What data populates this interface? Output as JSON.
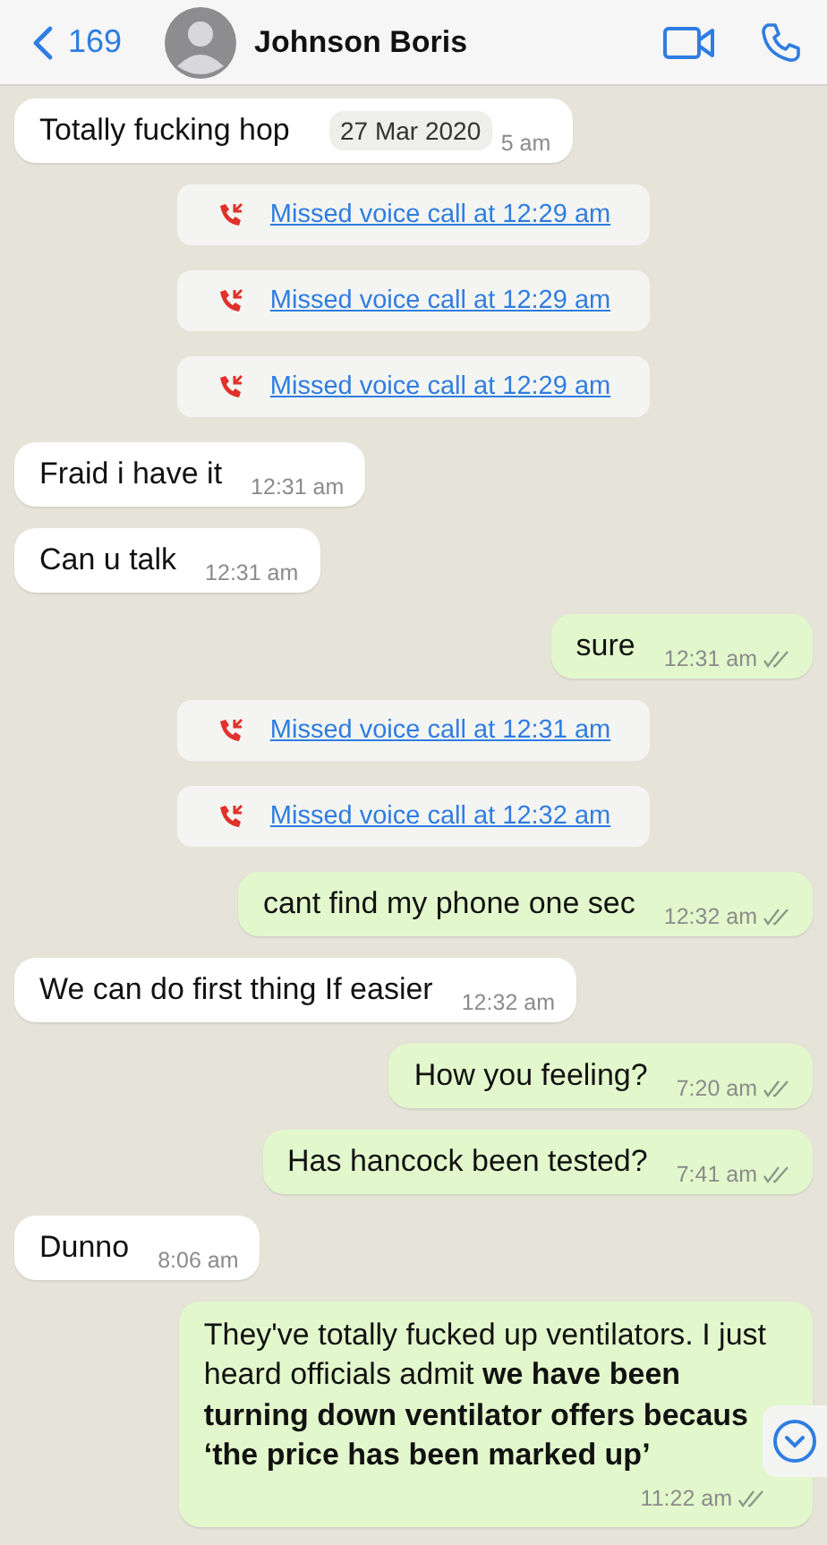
{
  "header": {
    "back_count": "169",
    "contact_name": "Johnson Boris"
  },
  "date_chip": "27 Mar 2020",
  "messages": [
    {
      "kind": "incoming",
      "text": "Totally fucking hop",
      "time": "5 am"
    },
    {
      "kind": "call",
      "text": "Missed voice call at 12:29 am"
    },
    {
      "kind": "call",
      "text": "Missed voice call at 12:29 am"
    },
    {
      "kind": "call",
      "text": "Missed voice call at 12:29 am"
    },
    {
      "kind": "incoming",
      "text": "Fraid i have it",
      "time": "12:31 am"
    },
    {
      "kind": "incoming",
      "text": "Can u talk",
      "time": "12:31 am"
    },
    {
      "kind": "outgoing",
      "text": "sure",
      "time": "12:31 am"
    },
    {
      "kind": "call",
      "text": "Missed voice call at 12:31 am"
    },
    {
      "kind": "call",
      "text": "Missed voice call at 12:32 am"
    },
    {
      "kind": "outgoing",
      "text": "cant find my phone one sec",
      "time": "12:32 am"
    },
    {
      "kind": "incoming",
      "text": "We can do first thing If easier",
      "time": "12:32 am"
    },
    {
      "kind": "outgoing",
      "text": "How you feeling?",
      "time": "7:20 am"
    },
    {
      "kind": "outgoing",
      "text": "Has hancock been tested?",
      "time": "7:41 am"
    },
    {
      "kind": "incoming",
      "text": "Dunno",
      "time": "8:06 am"
    },
    {
      "kind": "outgoing",
      "lines": [
        "They've totally fucked up ventilators. I just",
        "heard officials admit **we have been**",
        "**turning down ventilator offers becaus**",
        "**‘the price has been marked up’**"
      ],
      "time": "11:22 am"
    }
  ]
}
